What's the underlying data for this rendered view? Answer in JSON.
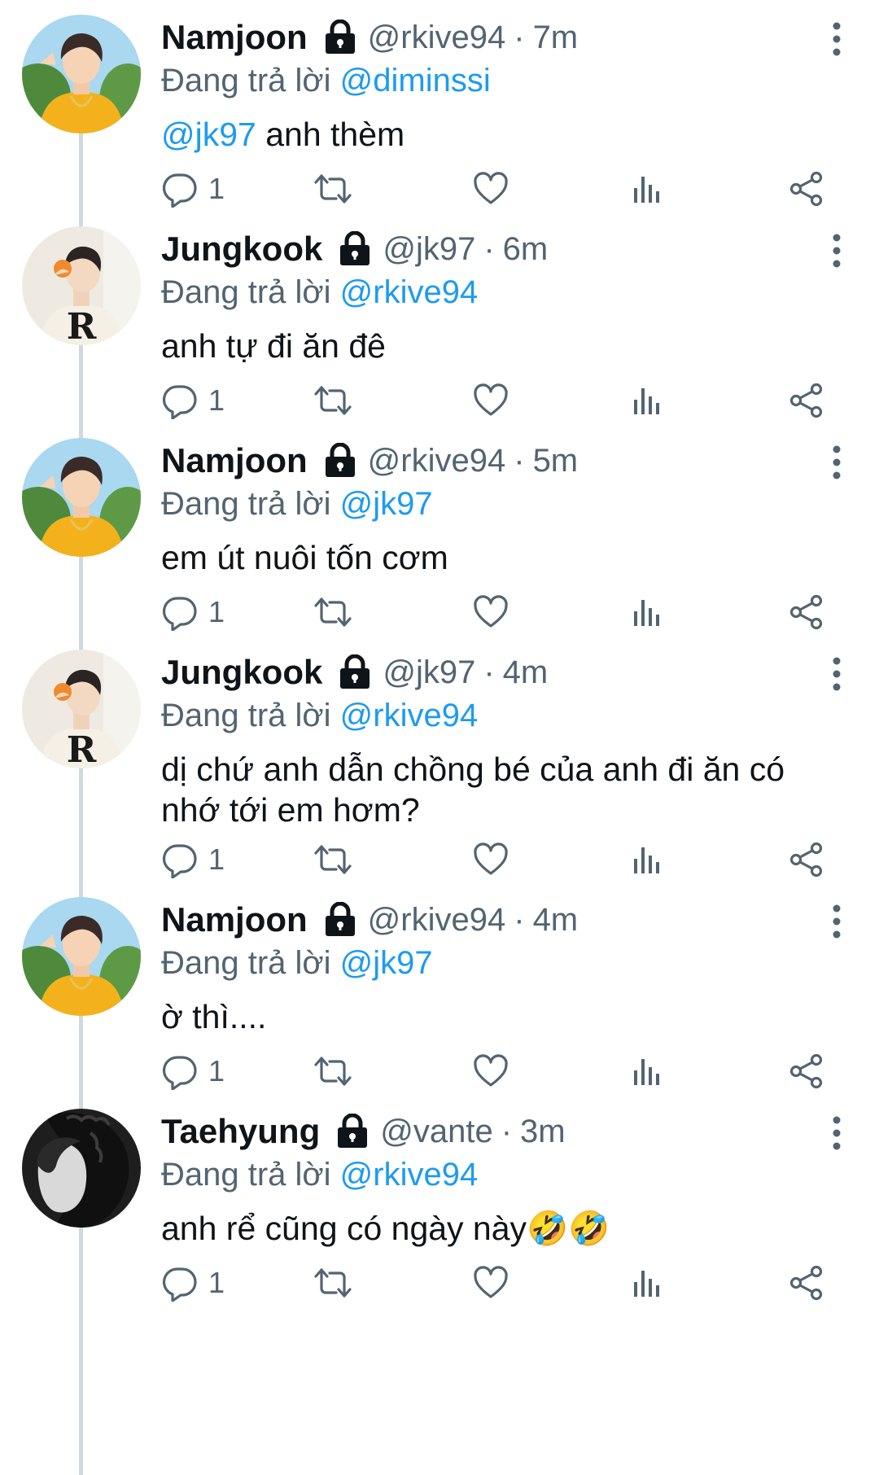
{
  "reply_prefix": "Đang trả lời",
  "tweets": [
    {
      "name": "Namjoon",
      "handle": "@rkive94",
      "separator": "·",
      "time": "7m",
      "replying_to": "@diminssi",
      "body_mention": "@jk97",
      "body_text": " anh thèm",
      "reply_count": "1",
      "avatar_icon": "namjoon-avatar-icon"
    },
    {
      "name": "Jungkook",
      "handle": "@jk97",
      "separator": "·",
      "time": "6m",
      "replying_to": "@rkive94",
      "body_mention": "",
      "body_text": "anh tự đi ăn đê",
      "reply_count": "1",
      "avatar_icon": "jungkook-avatar-icon"
    },
    {
      "name": "Namjoon",
      "handle": "@rkive94",
      "separator": "·",
      "time": "5m",
      "replying_to": "@jk97",
      "body_mention": "",
      "body_text": "em út nuôi tốn cơm",
      "reply_count": "1",
      "avatar_icon": "namjoon-avatar-icon"
    },
    {
      "name": "Jungkook",
      "handle": "@jk97",
      "separator": "·",
      "time": "4m",
      "replying_to": "@rkive94",
      "body_mention": "",
      "body_text": "dị chứ anh dẫn chồng bé của anh đi ăn có nhớ tới em hơm?",
      "reply_count": "1",
      "avatar_icon": "jungkook-avatar-icon"
    },
    {
      "name": "Namjoon",
      "handle": "@rkive94",
      "separator": "·",
      "time": "4m",
      "replying_to": "@jk97",
      "body_mention": "",
      "body_text": "ờ thì....",
      "reply_count": "1",
      "avatar_icon": "namjoon-avatar-icon"
    },
    {
      "name": "Taehyung",
      "handle": "@vante",
      "separator": "·",
      "time": "3m",
      "replying_to": "@rkive94",
      "body_mention": "",
      "body_text": "anh rể cũng có ngày này🤣🤣",
      "reply_count": "1",
      "avatar_icon": "taehyung-avatar-icon"
    }
  ],
  "colors": {
    "text": "#0f1419",
    "secondary": "#536471",
    "mention": "#1d9bf0",
    "thread_line": "#cfd9de"
  },
  "icons": [
    "lock-icon",
    "more-icon",
    "reply-icon",
    "retweet-icon",
    "like-icon",
    "views-icon",
    "share-icon"
  ]
}
